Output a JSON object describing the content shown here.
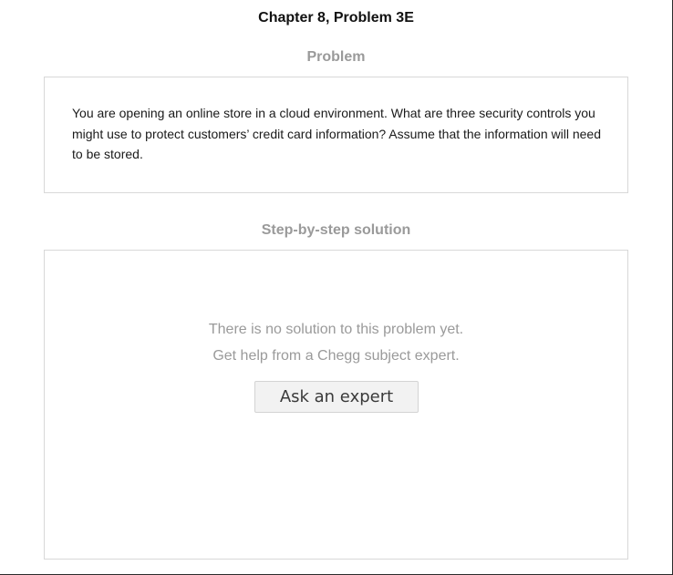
{
  "header": {
    "title": "Chapter 8, Problem 3E"
  },
  "problem": {
    "heading": "Problem",
    "text": "You are opening an online store in a cloud environment. What are three security controls you might use to protect customers’ credit card information? Assume that the information will need to be stored."
  },
  "solution": {
    "heading": "Step-by-step solution",
    "empty_message_line1": "There is no solution to this problem yet.",
    "empty_message_line2": "Get help from a Chegg subject expert.",
    "ask_button_label": "Ask an expert"
  }
}
